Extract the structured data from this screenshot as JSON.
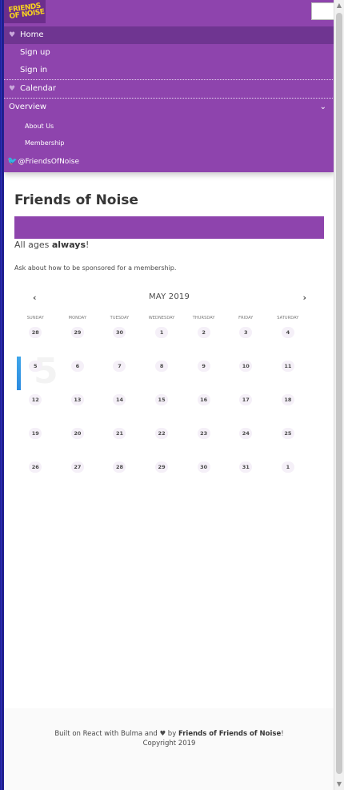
{
  "brand": {
    "logo_text": "FRIENDS OF NOISE"
  },
  "nav": {
    "items": [
      {
        "label": "Home"
      },
      {
        "label": "Sign up"
      },
      {
        "label": "Sign in"
      },
      {
        "label": "Calendar"
      }
    ],
    "overview": {
      "label": "Overview",
      "subitems": [
        {
          "label": "About Us"
        },
        {
          "label": "Membership"
        }
      ]
    },
    "twitter": "@FriendsOfNoise"
  },
  "main": {
    "title": "Friends of Noise",
    "tagline_prefix": "All ages ",
    "tagline_bold": "always",
    "tagline_suffix": "!",
    "note": "Ask about how to be sponsored for a membership."
  },
  "calendar": {
    "month": "MAY 2019",
    "prev": "‹",
    "next": "›",
    "weekdays": [
      "SUNDAY",
      "MONDAY",
      "TUESDAY",
      "WEDNESDAY",
      "THURSDAY",
      "FRIDAY",
      "SATURDAY"
    ],
    "weeks": [
      [
        "28",
        "29",
        "30",
        "1",
        "2",
        "3",
        "4"
      ],
      [
        "5",
        "6",
        "7",
        "8",
        "9",
        "10",
        "11"
      ],
      [
        "12",
        "13",
        "14",
        "15",
        "16",
        "17",
        "18"
      ],
      [
        "19",
        "20",
        "21",
        "22",
        "23",
        "24",
        "25"
      ],
      [
        "26",
        "27",
        "28",
        "29",
        "30",
        "31",
        "1"
      ]
    ],
    "today_big": "5"
  },
  "footer": {
    "built": "Built on React with Bulma and ",
    "heart": "♥",
    "by": " by ",
    "org": "Friends of Friends of Noise",
    "bang": "!",
    "copyright": "Copyright 2019"
  },
  "colors": {
    "accent": "#8e44ad",
    "accent_dark": "#6f3591"
  }
}
